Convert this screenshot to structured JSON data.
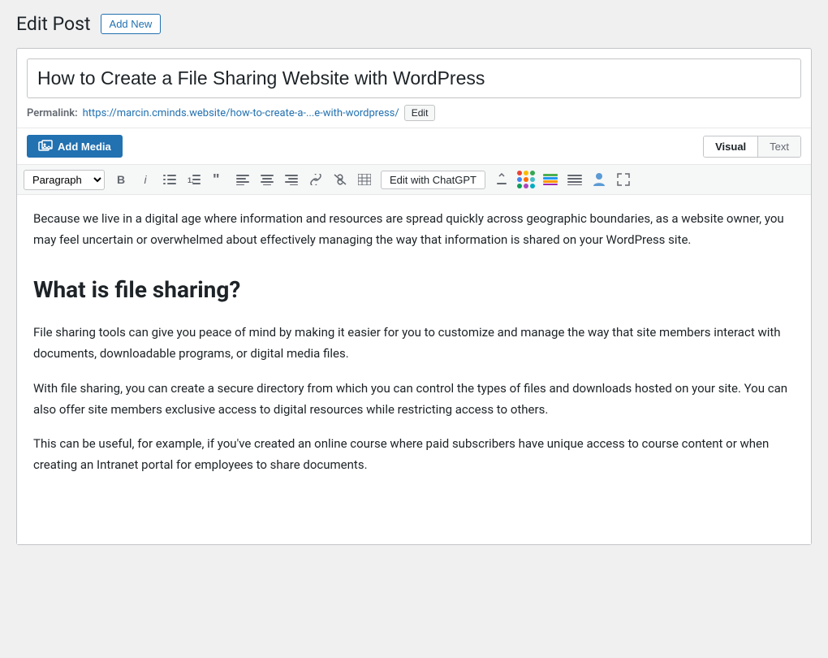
{
  "header": {
    "title": "Edit Post",
    "add_new_label": "Add New"
  },
  "post": {
    "title": "How to Create a File Sharing Website with WordPress",
    "permalink_label": "Permalink:",
    "permalink_url": "https://marcin.cminds.website/how-to-create-a-...e-with-wordpress/",
    "permalink_edit_label": "Edit"
  },
  "toolbar": {
    "add_media_label": "Add Media",
    "visual_label": "Visual",
    "text_label": "Text",
    "paragraph_select": "Paragraph",
    "bold_label": "B",
    "italic_label": "i",
    "chatgpt_label": "Edit with ChatGPT"
  },
  "content": {
    "paragraph1": "Because we live in a digital age where information and resources are spread quickly across geographic boundaries, as a website owner, you may feel uncertain or overwhelmed about effectively managing the way that information is shared on your WordPress site.",
    "heading1": "What is file sharing?",
    "paragraph2": "File sharing tools can give you peace of mind by making it easier for you to customize and manage the way that site members interact with documents, downloadable programs, or digital media files.",
    "paragraph3": "With file sharing, you can create a secure directory from which you can control the types of files and downloads hosted on your site. You can also offer site members exclusive access to digital resources while restricting access to others.",
    "paragraph4": "This can be useful, for example, if you've created an online course where paid subscribers have unique access to course content or when creating an Intranet portal for employees to share documents."
  },
  "colors": {
    "brand_blue": "#2271b1",
    "text_dark": "#1d2327",
    "border_gray": "#c3c4c7",
    "bg_light": "#f6f7f7",
    "dot1": "#ea4335",
    "dot2": "#fbbc04",
    "dot3": "#34a853",
    "dot4": "#4285f4",
    "dot5": "#ff6d00",
    "dot6": "#46bdc6",
    "dot7": "#0f9d58",
    "dot8": "#ab47bc",
    "dot9": "#00acc1"
  }
}
